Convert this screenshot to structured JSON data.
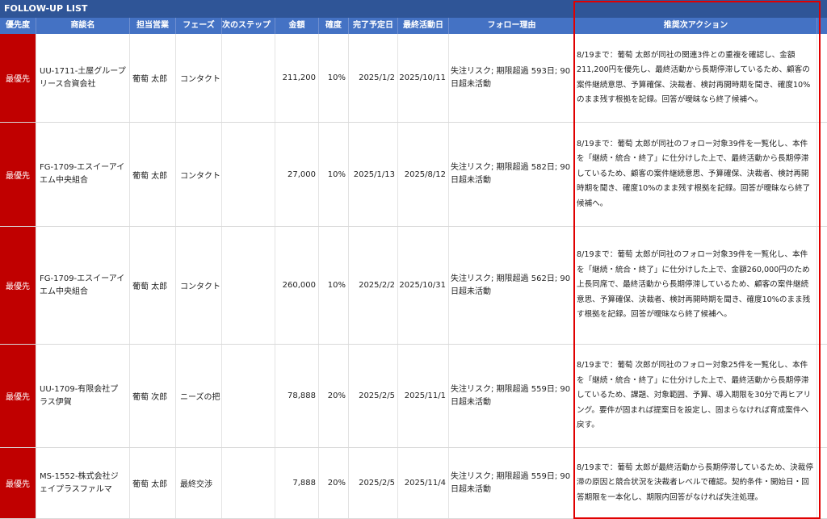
{
  "sheet": {
    "title": "FOLLOW-UP LIST",
    "headers": {
      "priority": "優先度",
      "deal": "商談名",
      "sales": "担当営業",
      "phase": "フェーズ",
      "next_step": "次のステップ",
      "amount": "金額",
      "confidence": "確度",
      "due_date": "完了予定日",
      "last_activity": "最終活動日",
      "reason": "フォロー理由",
      "action": "推奨次アクション"
    },
    "rows": [
      {
        "priority": "最優先",
        "deal": "UU-1711-土屋グループリース合資会社",
        "sales": "葡萄 太郎",
        "phase": "コンタクト",
        "next_step": "",
        "amount": "211,200",
        "confidence": "10%",
        "due_date": "2025/1/2",
        "last_activity": "2025/10/11",
        "reason": "失注リスク; 期限超過 593日; 90日超未活動",
        "action": "8/19まで：葡萄 太郎が同社の関連3件との重複を確認し、金額211,200円を優先し、最終活動から長期停滞しているため、顧客の案件継続意思、予算確保、決裁者、検討再開時期を聞き、確度10%のまま残す根拠を記録。回答が曖昧なら終了候補へ。"
      },
      {
        "priority": "最優先",
        "deal": "FG-1709-エスイーアイエム中央組合",
        "sales": "葡萄 太郎",
        "phase": "コンタクト",
        "next_step": "",
        "amount": "27,000",
        "confidence": "10%",
        "due_date": "2025/1/13",
        "last_activity": "2025/8/12",
        "reason": "失注リスク; 期限超過 582日; 90日超未活動",
        "action": "8/19まで：葡萄 太郎が同社のフォロー対象39件を一覧化し、本件を「継続・統合・終了」に仕分けした上で、最終活動から長期停滞しているため、顧客の案件継続意思、予算確保、決裁者、検討再開時期を聞き、確度10%のまま残す根拠を記録。回答が曖昧なら終了候補へ。"
      },
      {
        "priority": "最優先",
        "deal": "FG-1709-エスイーアイエム中央組合",
        "sales": "葡萄 太郎",
        "phase": "コンタクト",
        "next_step": "",
        "amount": "260,000",
        "confidence": "10%",
        "due_date": "2025/2/2",
        "last_activity": "2025/10/31",
        "reason": "失注リスク; 期限超過 562日; 90日超未活動",
        "action": "8/19まで：葡萄 太郎が同社のフォロー対象39件を一覧化し、本件を「継続・統合・終了」に仕分けした上で、金額260,000円のため上長同席で、最終活動から長期停滞しているため、顧客の案件継続意思、予算確保、決裁者、検討再開時期を聞き、確度10%のまま残す根拠を記録。回答が曖昧なら終了候補へ。"
      },
      {
        "priority": "最優先",
        "deal": "UU-1709-有限会社プラス伊賀",
        "sales": "葡萄 次郎",
        "phase": "ニーズの把",
        "next_step": "",
        "amount": "78,888",
        "confidence": "20%",
        "due_date": "2025/2/5",
        "last_activity": "2025/11/1",
        "reason": "失注リスク; 期限超過 559日; 90日超未活動",
        "action": "8/19まで：葡萄 次郎が同社のフォロー対象25件を一覧化し、本件を「継続・統合・終了」に仕分けした上で、最終活動から長期停滞しているため、課題、対象範囲、予算、導入期限を30分で再ヒアリング。要件が固まれば提案日を設定し、固まらなければ育成案件へ戻す。"
      },
      {
        "priority": "最優先",
        "deal": "MS-1552-株式会社ジェイプラスファルマ",
        "sales": "葡萄 太郎",
        "phase": "最終交渉",
        "next_step": "",
        "amount": "7,888",
        "confidence": "20%",
        "due_date": "2025/2/5",
        "last_activity": "2025/11/4",
        "reason": "失注リスク; 期限超過 559日; 90日超未活動",
        "action": "8/19まで：葡萄 太郎が最終活動から長期停滞しているため、決裁停滞の原因と競合状況を決裁者レベルで確認。契約条件・開始日・回答期限を一本化し、期限内回答がなければ失注処理。"
      }
    ]
  }
}
